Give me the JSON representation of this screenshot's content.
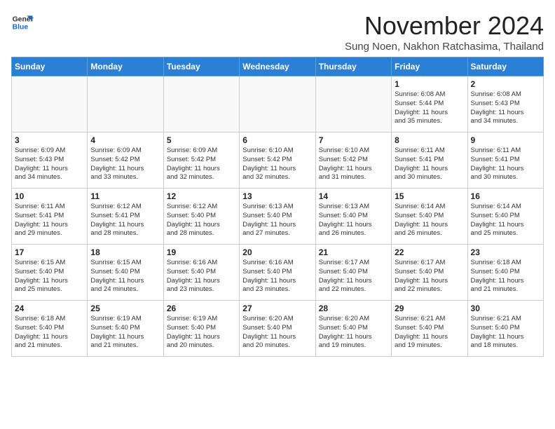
{
  "header": {
    "logo_general": "General",
    "logo_blue": "Blue",
    "month_title": "November 2024",
    "subtitle": "Sung Noen, Nakhon Ratchasima, Thailand"
  },
  "days_of_week": [
    "Sunday",
    "Monday",
    "Tuesday",
    "Wednesday",
    "Thursday",
    "Friday",
    "Saturday"
  ],
  "weeks": [
    [
      {
        "day": "",
        "info": ""
      },
      {
        "day": "",
        "info": ""
      },
      {
        "day": "",
        "info": ""
      },
      {
        "day": "",
        "info": ""
      },
      {
        "day": "",
        "info": ""
      },
      {
        "day": "1",
        "info": "Sunrise: 6:08 AM\nSunset: 5:44 PM\nDaylight: 11 hours\nand 35 minutes."
      },
      {
        "day": "2",
        "info": "Sunrise: 6:08 AM\nSunset: 5:43 PM\nDaylight: 11 hours\nand 34 minutes."
      }
    ],
    [
      {
        "day": "3",
        "info": "Sunrise: 6:09 AM\nSunset: 5:43 PM\nDaylight: 11 hours\nand 34 minutes."
      },
      {
        "day": "4",
        "info": "Sunrise: 6:09 AM\nSunset: 5:42 PM\nDaylight: 11 hours\nand 33 minutes."
      },
      {
        "day": "5",
        "info": "Sunrise: 6:09 AM\nSunset: 5:42 PM\nDaylight: 11 hours\nand 32 minutes."
      },
      {
        "day": "6",
        "info": "Sunrise: 6:10 AM\nSunset: 5:42 PM\nDaylight: 11 hours\nand 32 minutes."
      },
      {
        "day": "7",
        "info": "Sunrise: 6:10 AM\nSunset: 5:42 PM\nDaylight: 11 hours\nand 31 minutes."
      },
      {
        "day": "8",
        "info": "Sunrise: 6:11 AM\nSunset: 5:41 PM\nDaylight: 11 hours\nand 30 minutes."
      },
      {
        "day": "9",
        "info": "Sunrise: 6:11 AM\nSunset: 5:41 PM\nDaylight: 11 hours\nand 30 minutes."
      }
    ],
    [
      {
        "day": "10",
        "info": "Sunrise: 6:11 AM\nSunset: 5:41 PM\nDaylight: 11 hours\nand 29 minutes."
      },
      {
        "day": "11",
        "info": "Sunrise: 6:12 AM\nSunset: 5:41 PM\nDaylight: 11 hours\nand 28 minutes."
      },
      {
        "day": "12",
        "info": "Sunrise: 6:12 AM\nSunset: 5:40 PM\nDaylight: 11 hours\nand 28 minutes."
      },
      {
        "day": "13",
        "info": "Sunrise: 6:13 AM\nSunset: 5:40 PM\nDaylight: 11 hours\nand 27 minutes."
      },
      {
        "day": "14",
        "info": "Sunrise: 6:13 AM\nSunset: 5:40 PM\nDaylight: 11 hours\nand 26 minutes."
      },
      {
        "day": "15",
        "info": "Sunrise: 6:14 AM\nSunset: 5:40 PM\nDaylight: 11 hours\nand 26 minutes."
      },
      {
        "day": "16",
        "info": "Sunrise: 6:14 AM\nSunset: 5:40 PM\nDaylight: 11 hours\nand 25 minutes."
      }
    ],
    [
      {
        "day": "17",
        "info": "Sunrise: 6:15 AM\nSunset: 5:40 PM\nDaylight: 11 hours\nand 25 minutes."
      },
      {
        "day": "18",
        "info": "Sunrise: 6:15 AM\nSunset: 5:40 PM\nDaylight: 11 hours\nand 24 minutes."
      },
      {
        "day": "19",
        "info": "Sunrise: 6:16 AM\nSunset: 5:40 PM\nDaylight: 11 hours\nand 23 minutes."
      },
      {
        "day": "20",
        "info": "Sunrise: 6:16 AM\nSunset: 5:40 PM\nDaylight: 11 hours\nand 23 minutes."
      },
      {
        "day": "21",
        "info": "Sunrise: 6:17 AM\nSunset: 5:40 PM\nDaylight: 11 hours\nand 22 minutes."
      },
      {
        "day": "22",
        "info": "Sunrise: 6:17 AM\nSunset: 5:40 PM\nDaylight: 11 hours\nand 22 minutes."
      },
      {
        "day": "23",
        "info": "Sunrise: 6:18 AM\nSunset: 5:40 PM\nDaylight: 11 hours\nand 21 minutes."
      }
    ],
    [
      {
        "day": "24",
        "info": "Sunrise: 6:18 AM\nSunset: 5:40 PM\nDaylight: 11 hours\nand 21 minutes."
      },
      {
        "day": "25",
        "info": "Sunrise: 6:19 AM\nSunset: 5:40 PM\nDaylight: 11 hours\nand 21 minutes."
      },
      {
        "day": "26",
        "info": "Sunrise: 6:19 AM\nSunset: 5:40 PM\nDaylight: 11 hours\nand 20 minutes."
      },
      {
        "day": "27",
        "info": "Sunrise: 6:20 AM\nSunset: 5:40 PM\nDaylight: 11 hours\nand 20 minutes."
      },
      {
        "day": "28",
        "info": "Sunrise: 6:20 AM\nSunset: 5:40 PM\nDaylight: 11 hours\nand 19 minutes."
      },
      {
        "day": "29",
        "info": "Sunrise: 6:21 AM\nSunset: 5:40 PM\nDaylight: 11 hours\nand 19 minutes."
      },
      {
        "day": "30",
        "info": "Sunrise: 6:21 AM\nSunset: 5:40 PM\nDaylight: 11 hours\nand 18 minutes."
      }
    ]
  ]
}
